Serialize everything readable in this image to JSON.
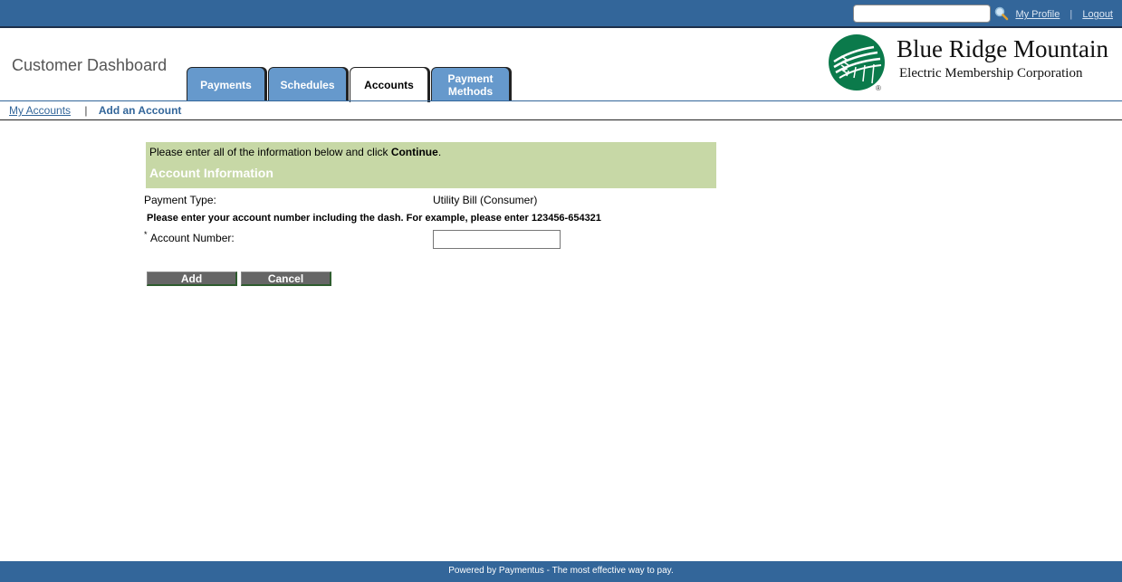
{
  "topbar": {
    "search_placeholder": "",
    "search_value": "",
    "links": [
      {
        "label": "My Profile"
      },
      {
        "label": "Logout"
      }
    ],
    "separator": "|"
  },
  "header": {
    "title": "Customer Dashboard",
    "tabs": [
      {
        "label": "Payments",
        "active": false
      },
      {
        "label": "Schedules",
        "active": false
      },
      {
        "label": "Accounts",
        "active": true
      },
      {
        "label_line1": "Payment",
        "label_line2": "Methods",
        "active": false
      }
    ],
    "logo": {
      "title": "Blue Ridge Mountain",
      "subtitle": "Electric Membership Corporation",
      "registered": "®",
      "color": "#0b7a4b"
    }
  },
  "subnav": {
    "items": [
      {
        "label": "My Accounts",
        "link": true
      },
      {
        "label": "Add an Account",
        "link": false,
        "current": true
      }
    ],
    "separator": "|"
  },
  "form": {
    "instruction_prefix": "Please enter all of the information below and click ",
    "instruction_bold": "Continue",
    "instruction_suffix": ".",
    "section_title": "Account Information",
    "payment_type_label": "Payment Type:",
    "payment_type_value": "Utility Bill (Consumer)",
    "hint": "Please enter your account number including the dash. For example, please enter 123456-654321",
    "required_marker": "*",
    "account_number_label": "Account Number:",
    "account_number_value": "",
    "buttons": {
      "add": "Add",
      "cancel": "Cancel"
    }
  },
  "footer": {
    "text": "Powered by Paymentus - The most effective way to pay."
  },
  "colors": {
    "brand_blue": "#33669a",
    "tab_blue": "#6699cc",
    "instruction_bg": "#c7d8a6",
    "button_gray": "#666666"
  }
}
